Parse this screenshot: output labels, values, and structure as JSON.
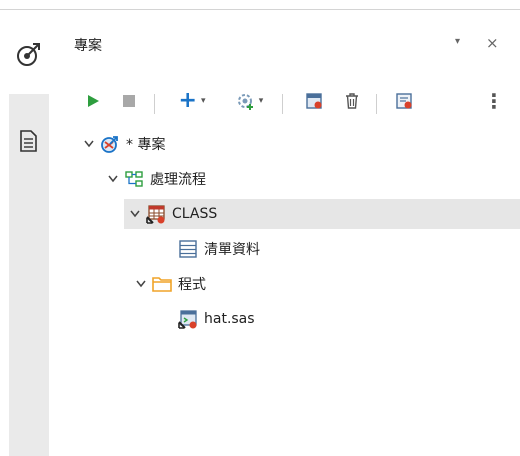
{
  "panel": {
    "title": "專案",
    "minimize_glyph": "▾",
    "close_glyph": "×"
  },
  "toolbar": {
    "run_icon": "run-icon",
    "stop_icon": "stop-icon",
    "add_label": "+",
    "dropdown_glyph": "▾",
    "more_glyph": "⋮"
  },
  "tree": {
    "project": {
      "label": "* 專案",
      "icon": "project-icon"
    },
    "flow": {
      "label": "處理流程",
      "icon": "process-flow-icon"
    },
    "class_table": {
      "label": "CLASS",
      "icon": "sas-table-icon"
    },
    "data_list": {
      "label": "清單資料",
      "icon": "list-data-icon"
    },
    "programs": {
      "label": "程式",
      "icon": "folder-icon"
    },
    "program_file": {
      "label": "hat.sas",
      "icon": "sas-program-icon"
    }
  },
  "colors": {
    "run_green": "#2e9e3f",
    "accent_blue": "#1a73c7",
    "folder_orange": "#f0a428",
    "selection": "#e6e6e6"
  }
}
